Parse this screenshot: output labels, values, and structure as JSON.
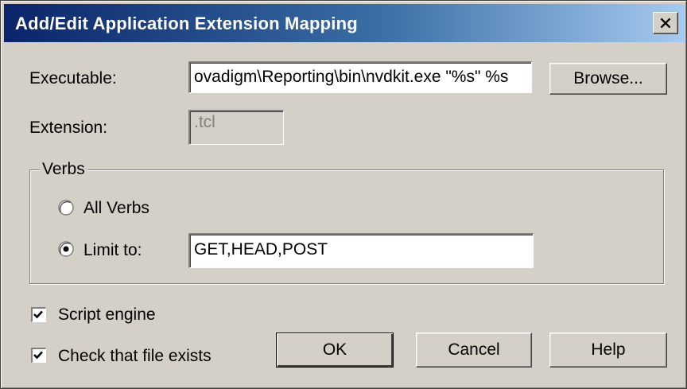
{
  "window": {
    "title": "Add/Edit Application Extension Mapping"
  },
  "executable": {
    "label": "Executable:",
    "value": "ovadigm\\Reporting\\bin\\nvdkit.exe \"%s\" %s",
    "browse_label": "Browse..."
  },
  "extension": {
    "label": "Extension:",
    "value": ".tcl"
  },
  "verbs": {
    "group_label": "Verbs",
    "all_verbs_label": "All Verbs",
    "limit_to_label": "Limit to:",
    "limit_to_value": "GET,HEAD,POST",
    "selected": "limit_to"
  },
  "options": {
    "script_engine_label": "Script engine",
    "script_engine_checked": true,
    "check_file_label": "Check that file exists",
    "check_file_checked": true
  },
  "buttons": {
    "ok": "OK",
    "cancel": "Cancel",
    "help": "Help"
  },
  "colors": {
    "face": "#d4d0c8",
    "title_start": "#0a246a",
    "title_end": "#a6caf0"
  }
}
